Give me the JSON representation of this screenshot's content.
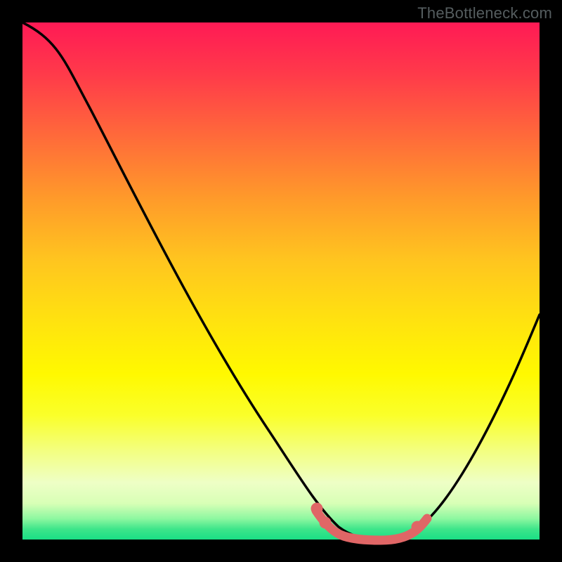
{
  "watermark": "TheBottleneck.com",
  "colors": {
    "background": "#000000",
    "curve_main": "#000000",
    "curve_highlight": "#e06666"
  },
  "chart_data": {
    "type": "line",
    "title": "",
    "xlabel": "",
    "ylabel": "",
    "xlim": [
      0,
      100
    ],
    "ylim": [
      0,
      100
    ],
    "annotations": [],
    "series": [
      {
        "name": "bottleneck-curve",
        "x": [
          0,
          6,
          12,
          18,
          24,
          30,
          36,
          42,
          48,
          52,
          56,
          59,
          62,
          65,
          68,
          71,
          74,
          78,
          82,
          86,
          90,
          94,
          98,
          100
        ],
        "values": [
          100,
          97,
          90,
          81,
          71,
          60,
          49,
          38,
          27,
          19,
          12,
          7,
          3,
          1,
          0,
          0,
          1,
          4,
          10,
          18,
          28,
          39,
          50,
          56
        ]
      },
      {
        "name": "trough-highlight",
        "x": [
          56,
          58,
          60,
          62,
          64,
          66,
          68,
          70,
          72,
          74,
          76
        ],
        "values": [
          6,
          4.2,
          2.7,
          1.5,
          0.6,
          0.1,
          0.0,
          0.3,
          1.1,
          2.2,
          4.0
        ]
      }
    ]
  }
}
